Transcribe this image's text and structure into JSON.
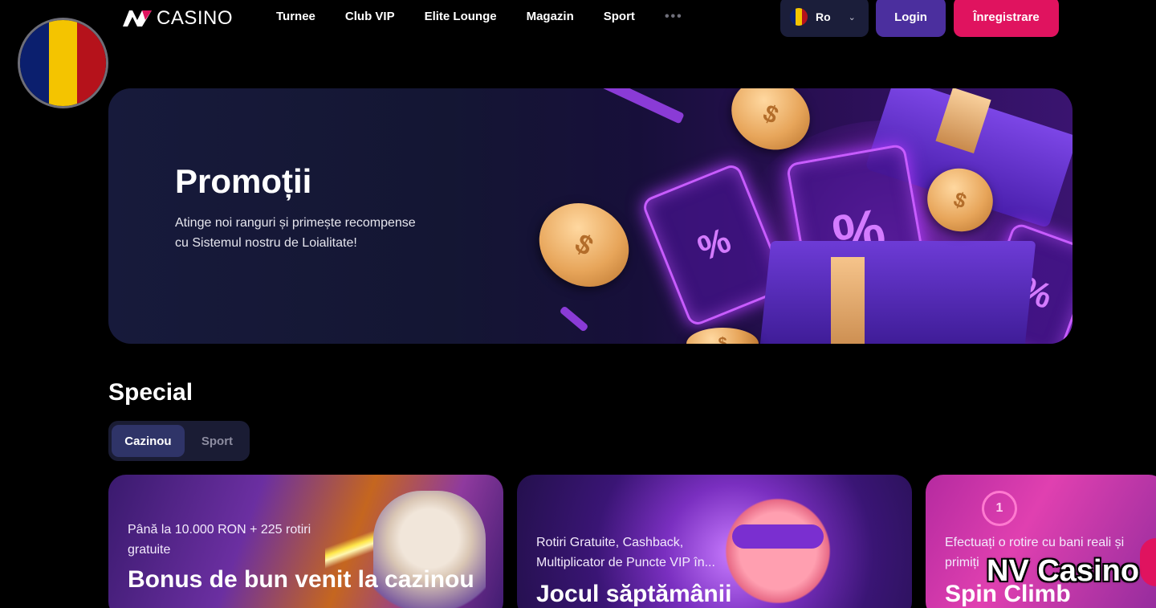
{
  "brand": {
    "logo_mark": "NV",
    "logo_text": "CASINO"
  },
  "nav": {
    "items": [
      "Turnee",
      "Club VIP",
      "Elite Lounge",
      "Magazin",
      "Sport"
    ],
    "more": "•••"
  },
  "header": {
    "language": "Ro",
    "login_label": "Login",
    "register_label": "Înregistrare"
  },
  "colors": {
    "flag_blue": "#0b1f6e",
    "flag_yellow": "#f4c400",
    "flag_red": "#b5121b",
    "accent_pink": "#e0135f",
    "accent_purple": "#4b2f9e"
  },
  "hero": {
    "title": "Promoții",
    "description": "Atinge noi ranguri și primește recompense cu Sistemul nostru de Loialitate!",
    "ticket_symbol": "%",
    "coin_symbol": "$"
  },
  "special": {
    "title": "Special",
    "tabs": [
      {
        "label": "Cazinou",
        "active": true
      },
      {
        "label": "Sport",
        "active": false
      }
    ]
  },
  "cards": [
    {
      "subtitle": "Până la 10.000 RON + 225 rotiri gratuite",
      "title": "Bonus de bun venit la cazinou"
    },
    {
      "subtitle": "Rotiri Gratuite, Cashback, Multiplicator de Puncte VIP în...",
      "title": "Jocul săptămânii"
    },
    {
      "subtitle": "Efectuați o rotire cu bani reali și primiți",
      "title": "Spin Climb",
      "badge": "1"
    }
  ],
  "watermark": "NV Casino",
  "icons": {
    "language_chevron": "chevron-down-icon",
    "chat": "chat-icon"
  }
}
